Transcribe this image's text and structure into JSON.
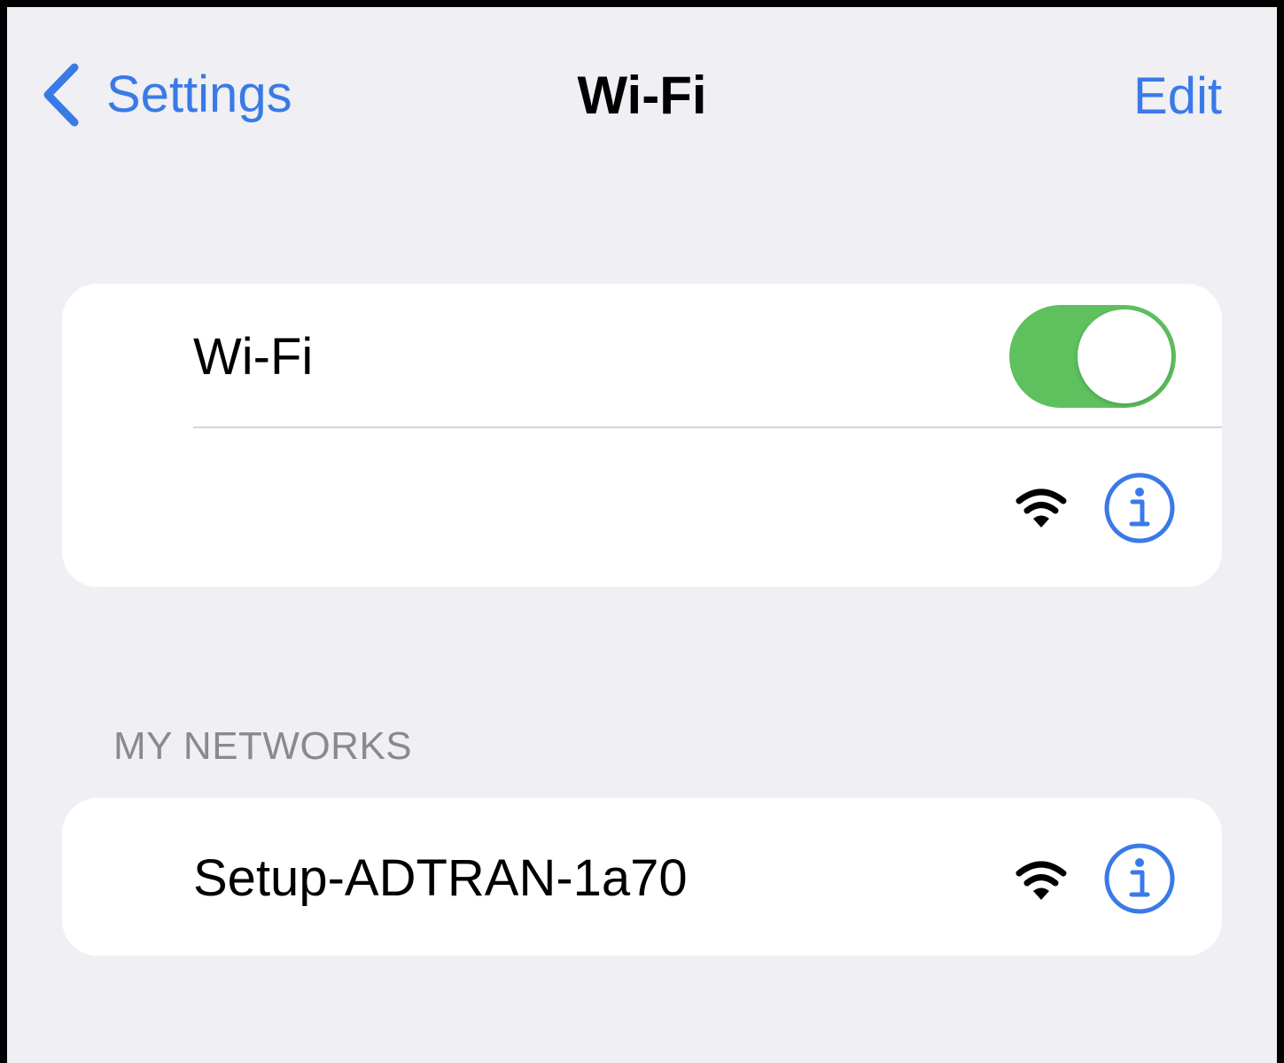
{
  "nav": {
    "back_label": "Settings",
    "title": "Wi-Fi",
    "edit_label": "Edit"
  },
  "wifi_card": {
    "toggle_label": "Wi-Fi",
    "toggle_on": true,
    "connected_network_name": ""
  },
  "my_networks": {
    "header": "MY NETWORKS",
    "items": [
      {
        "name": "Setup-ADTRAN-1a70"
      }
    ]
  },
  "icons": {
    "back": "chevron-left-icon",
    "wifi_signal": "wifi-signal-icon",
    "info": "info-circle-icon"
  },
  "colors": {
    "accent": "#3a7ae6",
    "toggle_on": "#5ec15e",
    "background": "#efeff4",
    "section_header": "#8a8a8e"
  }
}
